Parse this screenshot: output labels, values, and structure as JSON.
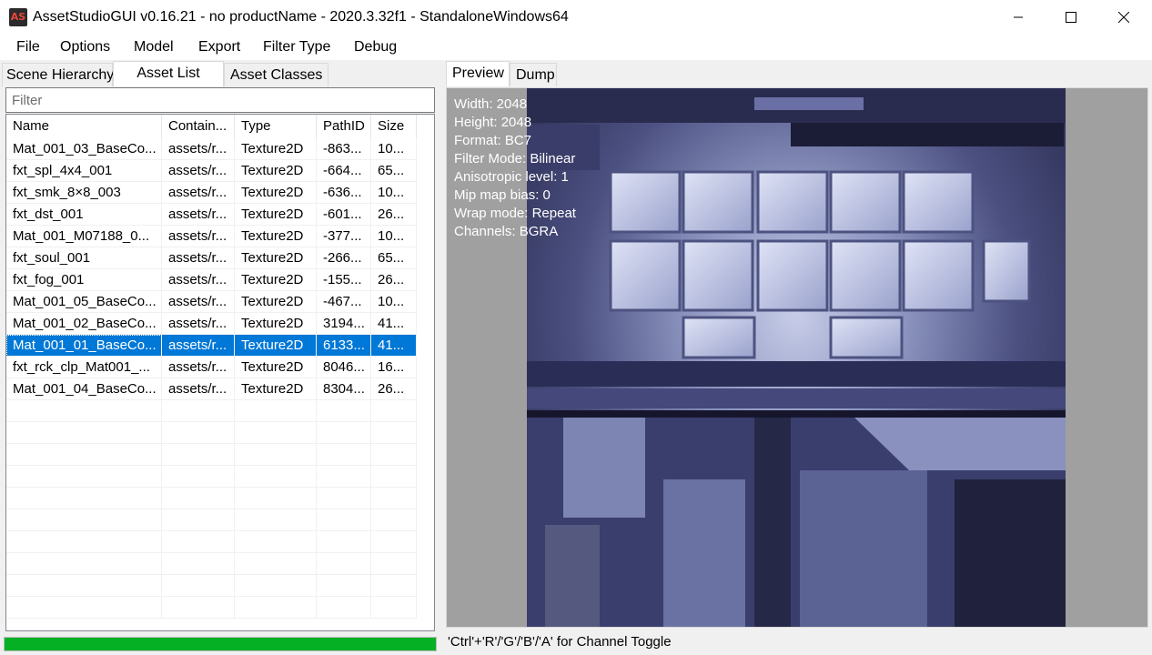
{
  "window": {
    "app_icon_text": "AS",
    "title": "AssetStudioGUI v0.16.21 - no productName - 2020.3.32f1 - StandaloneWindows64"
  },
  "menu": [
    "File",
    "Options",
    "Model",
    "Export",
    "Filter Type",
    "Debug"
  ],
  "left_tabs": [
    "Scene Hierarchy",
    "Asset List",
    "Asset Classes"
  ],
  "left_active_tab": "Asset List",
  "filter": {
    "placeholder": "Filter",
    "value": ""
  },
  "columns": [
    "Name",
    "Contain...",
    "Type",
    "PathID",
    "Size"
  ],
  "rows": [
    [
      "Mat_001_03_BaseCo...",
      "assets/r...",
      "Texture2D",
      "-863...",
      "10..."
    ],
    [
      "fxt_spl_4x4_001",
      "assets/r...",
      "Texture2D",
      "-664...",
      "65..."
    ],
    [
      "fxt_smk_8×8_003",
      "assets/r...",
      "Texture2D",
      "-636...",
      "10..."
    ],
    [
      "fxt_dst_001",
      "assets/r...",
      "Texture2D",
      "-601...",
      "26..."
    ],
    [
      "Mat_001_M07188_0...",
      "assets/r...",
      "Texture2D",
      "-377...",
      "10..."
    ],
    [
      "fxt_soul_001",
      "assets/r...",
      "Texture2D",
      "-266...",
      "65..."
    ],
    [
      "fxt_fog_001",
      "assets/r...",
      "Texture2D",
      "-155...",
      "26..."
    ],
    [
      "Mat_001_05_BaseCo...",
      "assets/r...",
      "Texture2D",
      "-467...",
      "10..."
    ],
    [
      "Mat_001_02_BaseCo...",
      "assets/r...",
      "Texture2D",
      "3194...",
      "41..."
    ],
    [
      "Mat_001_01_BaseCo...",
      "assets/r...",
      "Texture2D",
      "6133...",
      "41..."
    ],
    [
      "fxt_rck_clp_Mat001_...",
      "assets/r...",
      "Texture2D",
      "8046...",
      "16..."
    ],
    [
      "Mat_001_04_BaseCo...",
      "assets/r...",
      "Texture2D",
      "8304...",
      "26..."
    ]
  ],
  "selected_row": 9,
  "progress": 1.0,
  "right_tabs": [
    "Preview",
    "Dump"
  ],
  "right_active_tab": "Preview",
  "texture_info": [
    "Width: 2048",
    "Height: 2048",
    "Format: BC7",
    "Filter Mode: Bilinear",
    "Anisotropic level: 1",
    "Mip map bias: 0",
    "Wrap mode: Repeat",
    "Channels: BGRA"
  ],
  "status_hint": "'Ctrl'+'R'/'G'/'B'/'A' for Channel Toggle",
  "colors": {
    "selection": "#0078d7",
    "progress": "#06b025",
    "preview_bg": "#a0a0a0"
  }
}
